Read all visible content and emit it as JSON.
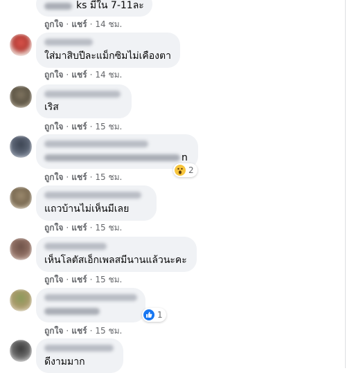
{
  "labels": {
    "like": "ถูกใจ",
    "separator": "·",
    "share": "แชร์"
  },
  "comments": [
    {
      "text_suffix": "ks มีใน 7-11ละ",
      "time": "14 ชม."
    },
    {
      "text": "ใส่มาสิบปีละแม็กซิมไม่เคืองตา",
      "time": "14 ชม."
    },
    {
      "text": "เริส",
      "time": "15 ชม."
    },
    {
      "text_suffix": "n",
      "time": "15 ชม.",
      "reaction": {
        "icon": "wow-emoji-icon",
        "count": "2"
      }
    },
    {
      "text": "แถวบ้านไม่เห็นมีเลย",
      "time": "15 ชม."
    },
    {
      "text": "เห็นโลตัสเอ็กเพลสมีนานแล้วนะคะ",
      "time": "15 ชม."
    },
    {
      "time": "15 ชม.",
      "reaction": {
        "icon": "like-thumb-icon",
        "count": "1"
      }
    },
    {
      "text": "ดีงามมาก"
    }
  ],
  "colors": {
    "bubble": "#f0f2f5",
    "secondary_text": "#65676b",
    "like_blue": "#1877f2",
    "wow_yellow": "#f7c53d"
  }
}
